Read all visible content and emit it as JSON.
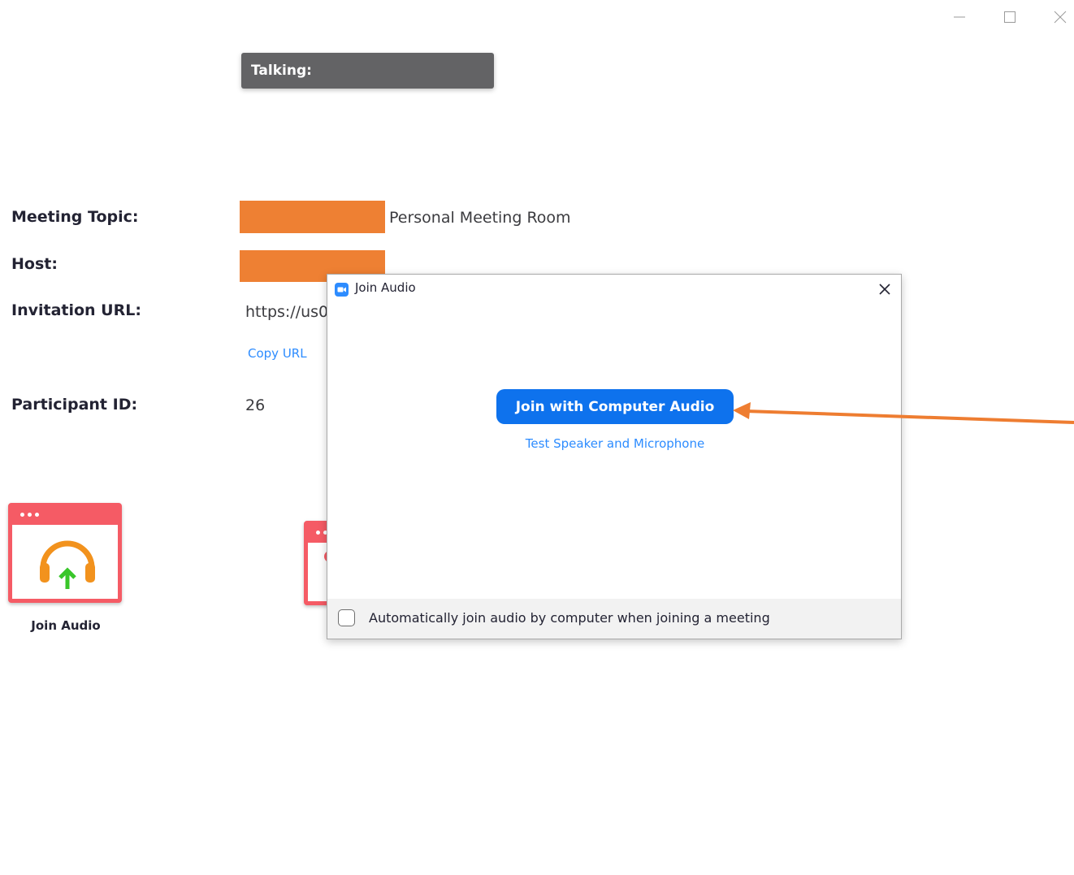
{
  "window_controls": {
    "minimize_icon": "minimize-icon",
    "maximize_icon": "maximize-icon",
    "close_icon": "close-icon"
  },
  "talking_bar": {
    "label": "Talking:"
  },
  "meeting_info": {
    "topic_label": "Meeting Topic:",
    "topic_value": "Personal Meeting Room",
    "host_label": "Host:",
    "invitation_label": "Invitation URL:",
    "invitation_value": "https://us0",
    "copy_url_label": "Copy URL",
    "participant_label": "Participant ID:",
    "participant_value": "26"
  },
  "tiles": {
    "join_audio_label": "Join Audio"
  },
  "dialog": {
    "title": "Join Audio",
    "join_button_label": "Join with Computer Audio",
    "test_link_label": "Test Speaker and Microphone",
    "auto_join_label": "Automatically join audio by computer when joining a meeting",
    "auto_join_checked": false
  },
  "colors": {
    "redaction": "#ee8033",
    "primary_blue": "#0e72ed",
    "link_blue": "#2d8cff",
    "tile_red": "#f55b65",
    "arrow_orange": "#ee7d31"
  }
}
